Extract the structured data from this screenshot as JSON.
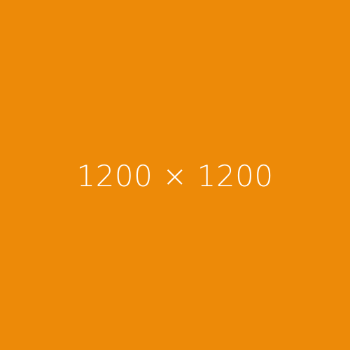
{
  "placeholder": {
    "label": "1200 × 1200",
    "background_color": "#ED8A08",
    "text_color": "#FFFFFF"
  }
}
